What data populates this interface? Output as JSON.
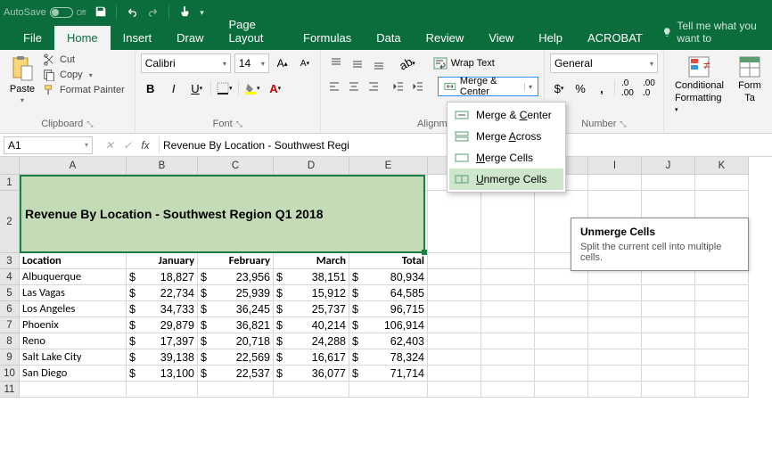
{
  "titlebar": {
    "autosave_label": "AutoSave",
    "autosave_state": "Off"
  },
  "tabs": [
    "File",
    "Home",
    "Insert",
    "Draw",
    "Page Layout",
    "Formulas",
    "Data",
    "Review",
    "View",
    "Help",
    "ACROBAT"
  ],
  "active_tab": "Home",
  "tellme": "Tell me what you want to",
  "clipboard": {
    "paste": "Paste",
    "cut": "Cut",
    "copy": "Copy",
    "format_painter": "Format Painter",
    "group": "Clipboard"
  },
  "font": {
    "name": "Calibri",
    "size": "14",
    "group": "Font"
  },
  "alignment": {
    "wrap": "Wrap Text",
    "merge": "Merge & Center",
    "group": "Alignm"
  },
  "merge_menu": {
    "center": "Merge & Center",
    "across": "Merge Across",
    "cells": "Merge Cells",
    "unmerge": "Unmerge Cells"
  },
  "tooltip": {
    "title": "Unmerge Cells",
    "body": "Split the current cell into multiple cells."
  },
  "number": {
    "format": "General",
    "group": "Number"
  },
  "styles": {
    "conditional": "Conditional",
    "formatting": "Formatting",
    "format_as": "Form",
    "table": "Ta"
  },
  "namebox": "A1",
  "formula": "Revenue By Location - Southwest Regi",
  "columns": [
    "A",
    "B",
    "C",
    "D",
    "E",
    "F",
    "G",
    "H",
    "I",
    "J",
    "K"
  ],
  "rows": [
    "1",
    "2",
    "3",
    "4",
    "5",
    "6",
    "7",
    "8",
    "9",
    "10",
    "11"
  ],
  "merged_title": "Revenue By Location - Southwest Region Q1 2018",
  "headers": {
    "location": "Location",
    "jan": "January",
    "feb": "February",
    "mar": "March",
    "total": "Total"
  },
  "data_rows": [
    {
      "loc": "Albuquerque",
      "jan": "18,827",
      "feb": "23,956",
      "mar": "38,151",
      "total": "80,934"
    },
    {
      "loc": "Las Vagas",
      "jan": "22,734",
      "feb": "25,939",
      "mar": "15,912",
      "total": "64,585"
    },
    {
      "loc": "Los Angeles",
      "jan": "34,733",
      "feb": "36,245",
      "mar": "25,737",
      "total": "96,715"
    },
    {
      "loc": "Phoenix",
      "jan": "29,879",
      "feb": "36,821",
      "mar": "40,214",
      "total": "106,914"
    },
    {
      "loc": "Reno",
      "jan": "17,397",
      "feb": "20,718",
      "mar": "24,288",
      "total": "62,403"
    },
    {
      "loc": "Salt Lake City",
      "jan": "39,138",
      "feb": "22,569",
      "mar": "16,617",
      "total": "78,324"
    },
    {
      "loc": "San Diego",
      "jan": "13,100",
      "feb": "22,537",
      "mar": "36,077",
      "total": "71,714"
    }
  ],
  "currency": "$"
}
